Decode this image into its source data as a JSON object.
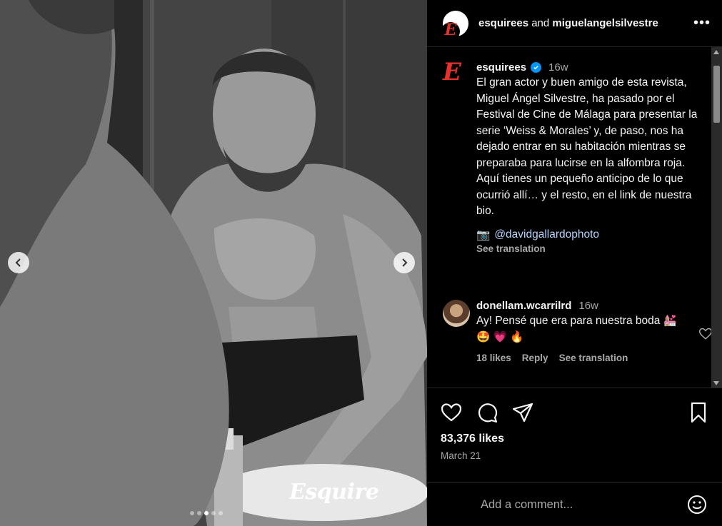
{
  "header": {
    "account_1": "esquirees",
    "joiner": "and",
    "account_2": "miguelangelsilvestre",
    "more_label": "•••"
  },
  "post": {
    "watermark": "Esquire",
    "carousel": {
      "total": 5,
      "active_index": 2
    },
    "caption": {
      "username": "esquirees",
      "time_ago": "16w",
      "text": "El gran actor y buen amigo de esta revista, Miguel Ángel Silvestre, ha pasado por el Festival de Cine de Málaga para presentar la serie ‘Weiss & Morales’ y, de paso, nos ha dejado entrar en su habitación mientras se preparaba para lucirse en la alfombra roja. Aquí tienes un pequeño anticipo de lo que ocurrió allí… y el resto, en el link de nuestra bio.",
      "camera_emoji": "📷",
      "credit": "@davidgallardophoto",
      "see_translation": "See translation"
    },
    "comment": {
      "username": "donellam.wcarrilrd",
      "time_ago": "16w",
      "text": "Ay! Pensé que era para nuestra boda 💒 🤩 💗 🔥",
      "likes": "18 likes",
      "reply": "Reply",
      "see_translation": "See translation"
    },
    "likes": "83,376 likes",
    "date": "March 21",
    "add_comment_placeholder": "Add a comment..."
  },
  "colors": {
    "brand_red": "#e4322b",
    "verified_blue": "#0095f6",
    "muted": "#a8a8a8"
  },
  "icons": [
    "chevron-left-icon",
    "chevron-right-icon",
    "verified-icon",
    "heart-icon",
    "comment-icon",
    "share-icon",
    "bookmark-icon",
    "emoji-icon",
    "more-icon"
  ]
}
